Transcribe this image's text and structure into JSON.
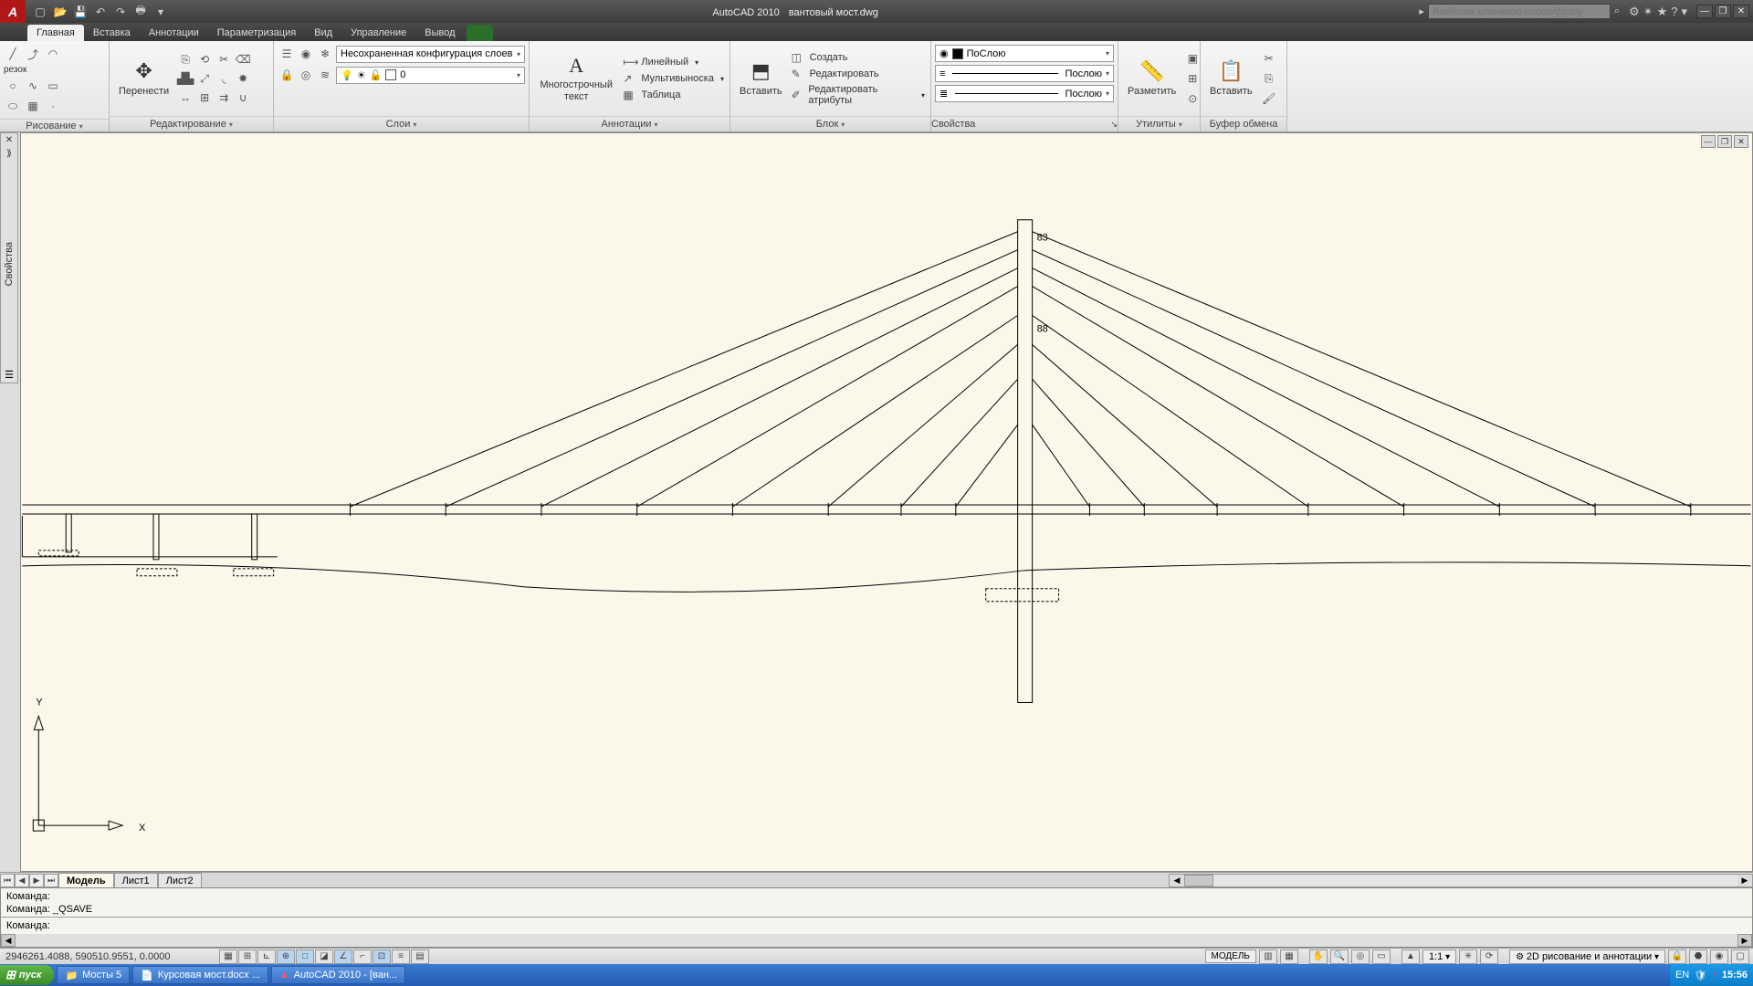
{
  "title": {
    "app": "AutoCAD 2010",
    "file": "вантовый мост.dwg"
  },
  "search": {
    "placeholder": "Введите ключевое слово/фразу"
  },
  "menutabs": [
    "Главная",
    "Вставка",
    "Аннотации",
    "Параметризация",
    "Вид",
    "Управление",
    "Вывод"
  ],
  "ribbon": {
    "draw": {
      "label": "Рисование",
      "cutoff": "резок"
    },
    "modify": {
      "label": "Редактирование",
      "move": "Перенести",
      "unsaved": "Несохраненная конфигурация слоев"
    },
    "layers": {
      "label": "Слои",
      "current": "0"
    },
    "annot": {
      "label": "Аннотации",
      "mtext": "Многострочный текст",
      "linear": "Линейный",
      "mleader": "Мультивыноска",
      "table": "Таблица"
    },
    "block": {
      "label": "Блок",
      "insert": "Вставить",
      "create": "Создать",
      "edit": "Редактировать",
      "editattr": "Редактировать атрибуты"
    },
    "props": {
      "label": "Свойства",
      "bylayer": "ПоСлою",
      "bylayer2": "Послою",
      "bylayer3": "Послою"
    },
    "utils": {
      "label": "Утилиты",
      "measure": "Разметить"
    },
    "clip": {
      "label": "Буфер обмена",
      "paste": "Вставить"
    }
  },
  "sidepanel": {
    "label": "Свойства"
  },
  "drawing": {
    "dim1": "83",
    "dim2": "88",
    "axisY": "Y",
    "axisX": "X"
  },
  "layouts": {
    "model": "Модель",
    "l1": "Лист1",
    "l2": "Лист2"
  },
  "cmd": {
    "line1": "Команда:",
    "line2": "Команда: _QSAVE",
    "prompt": "Команда:"
  },
  "status": {
    "coords": "2946261.4088, 590510.9551, 0.0000",
    "model": "МОДЕЛЬ",
    "scale": "1:1",
    "workspace": "2D рисование и аннотации"
  },
  "taskbar": {
    "start": "пуск",
    "t1": "Мосты 5",
    "t2": "Курсовая мост.docx ...",
    "t3": "AutoCAD 2010 - [ван...",
    "lang": "EN",
    "clock": "15:56"
  }
}
